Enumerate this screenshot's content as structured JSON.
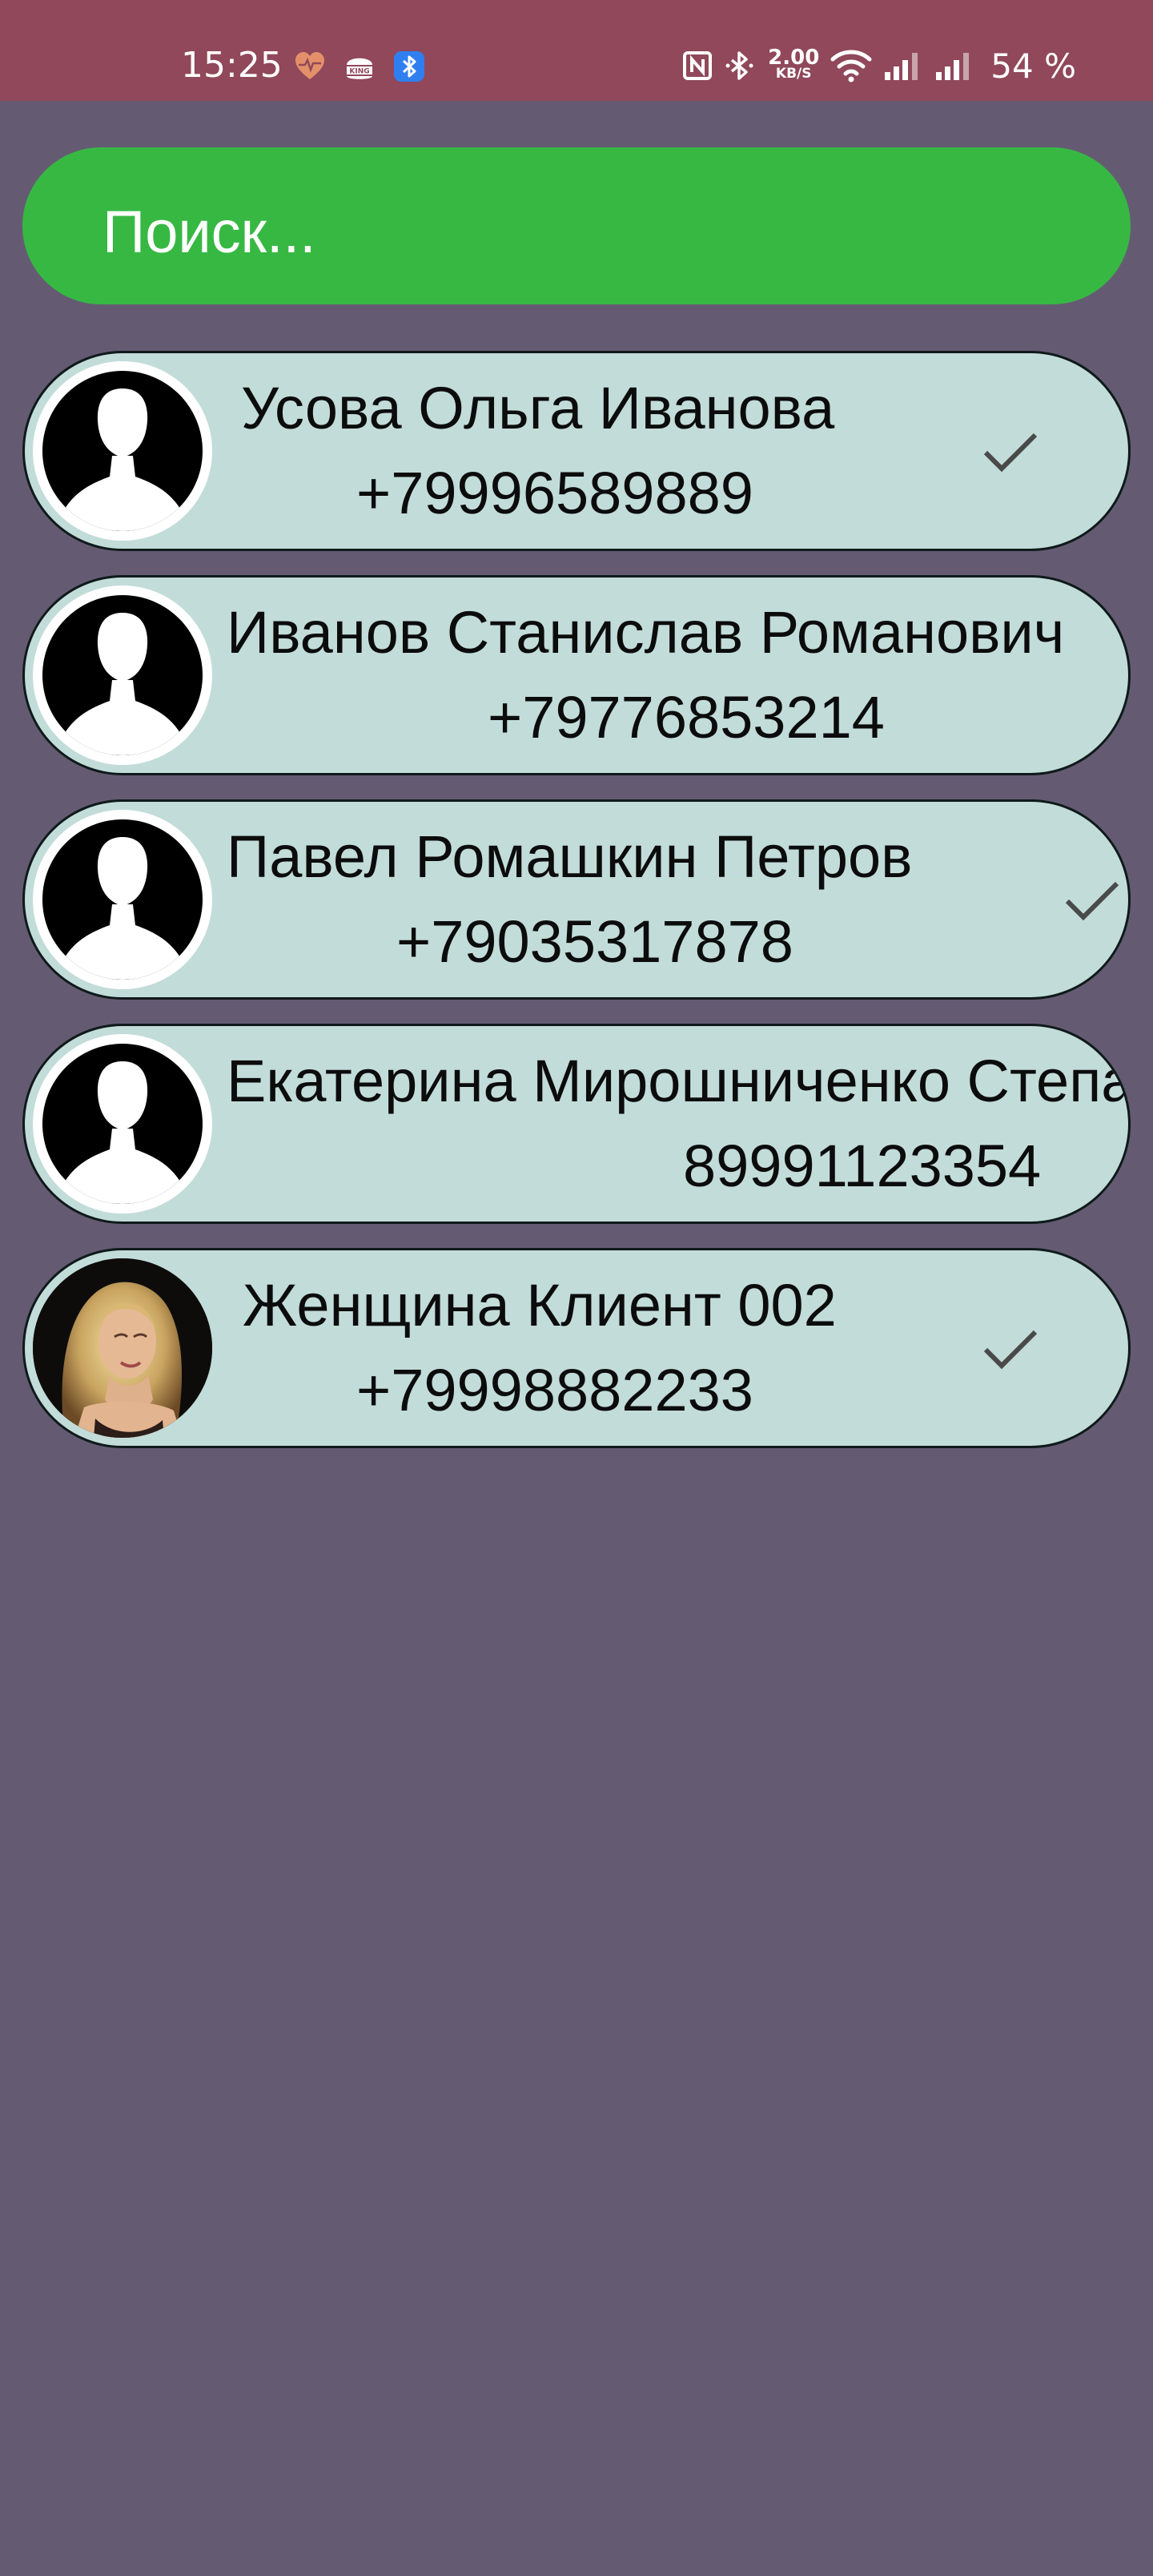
{
  "status_bar": {
    "time": "15:25",
    "speed_value": "2.00",
    "speed_unit": "KB/S",
    "battery": "54 %",
    "icons": [
      "heart-monitor-icon",
      "burger-king-icon",
      "bluetooth-app-icon",
      "nfc-icon",
      "bluetooth-icon",
      "wifi-icon",
      "signal-icon",
      "signal-icon"
    ]
  },
  "search": {
    "placeholder": "Поиск..."
  },
  "contacts": [
    {
      "name": "Усова Ольга Иванова",
      "phone": "+79996589889",
      "checked": true,
      "avatar": "default"
    },
    {
      "name": "Иванов Станислав  Романович",
      "phone": "+79776853214",
      "checked": false,
      "avatar": "default"
    },
    {
      "name": "Павел  Ромашкин Петров",
      "phone": "+79035317878",
      "checked": true,
      "avatar": "default"
    },
    {
      "name": "Екатерина  Мирошниченко Степановна",
      "phone": "89991123354",
      "checked": false,
      "avatar": "default"
    },
    {
      "name": "Женщина Клиент  002",
      "phone": "+79998882233",
      "checked": true,
      "avatar": "photo"
    }
  ],
  "colors": {
    "background": "#645b73",
    "status_bar": "#90485a",
    "search": "#37b843",
    "card": "#c2dcd9",
    "check": "#4a4a4a"
  }
}
